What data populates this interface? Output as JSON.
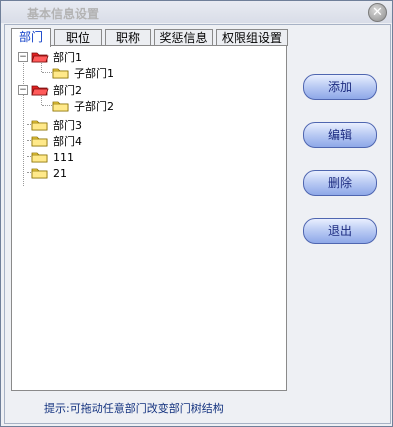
{
  "window": {
    "title": "基本信息设置",
    "close_glyph": "✕"
  },
  "tabs": [
    {
      "label": "部门"
    },
    {
      "label": "职位"
    },
    {
      "label": "职称"
    },
    {
      "label": "奖惩信息"
    },
    {
      "label": "权限组设置"
    }
  ],
  "tree": {
    "nodes": [
      {
        "label": "部门1",
        "expanded": true,
        "folder_color": "red"
      },
      {
        "label": "子部门1",
        "folder_color": "yellow"
      },
      {
        "label": "部门2",
        "expanded": true,
        "folder_color": "red"
      },
      {
        "label": "子部门2",
        "folder_color": "yellow"
      },
      {
        "label": "部门3",
        "folder_color": "yellow"
      },
      {
        "label": "部门4",
        "folder_color": "yellow"
      },
      {
        "label": "111",
        "folder_color": "yellow"
      },
      {
        "label": "21",
        "folder_color": "yellow"
      }
    ],
    "expander_glyph": "−"
  },
  "hint": "提示:可拖动任意部门改变部门树结构",
  "buttons": {
    "add": "添加",
    "edit": "编辑",
    "delete": "删除",
    "exit": "退出"
  },
  "colors": {
    "accent": "#1c2b80",
    "active_tab_text": "#0f3ec8",
    "folder_red": "#e12020",
    "folder_yellow": "#f3d34a"
  }
}
